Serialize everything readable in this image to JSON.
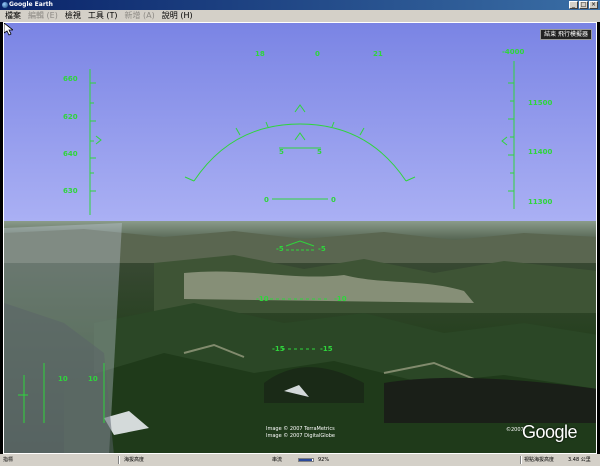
{
  "window": {
    "title": "Google Earth",
    "buttons": {
      "minimize": "_",
      "maximize": "□",
      "close": "×"
    }
  },
  "menubar": {
    "items": [
      {
        "label": "檔案",
        "enabled": true
      },
      {
        "label": "編輯 (E)",
        "enabled": false
      },
      {
        "label": "檢視",
        "enabled": true
      },
      {
        "label": "工具 (T)",
        "enabled": true
      },
      {
        "label": "新增 (A)",
        "enabled": false
      },
      {
        "label": "說明 (H)",
        "enabled": true
      }
    ]
  },
  "hud": {
    "exit_label": "結束 飛行模擬器",
    "heading_labels": [
      "18",
      "0",
      "21"
    ],
    "speed_ticks": [
      "660",
      "620",
      "640",
      "630"
    ],
    "altitude_top": "-4000",
    "altitude_ticks": [
      "11500",
      "11400",
      "11300"
    ],
    "bank_labels": [
      "5",
      "5"
    ],
    "pitch_zero": [
      "0",
      "0"
    ],
    "pitch_ladder": [
      {
        "left": "-5",
        "right": "-5"
      },
      {
        "left": "-10",
        "right": "-10"
      },
      {
        "left": "-15",
        "right": "-15"
      }
    ],
    "side_small": [
      "10",
      "10"
    ]
  },
  "attribution": {
    "line1": "Image © 2007 TerraMetrics",
    "line2": "Image © 2007 DigitalGlobe",
    "year": "©2007",
    "logo": "Google"
  },
  "statusbar": {
    "left": "指標",
    "elev": "海拔高度",
    "stream": "串流",
    "percent": "92%",
    "eye": "視點海拔高度",
    "eye_value": "3.48 公里",
    "progress": 0.92
  },
  "colors": {
    "hud": "#2fd53c",
    "sky_top": "#7a84e4",
    "sky_bottom": "#aab0f4"
  }
}
